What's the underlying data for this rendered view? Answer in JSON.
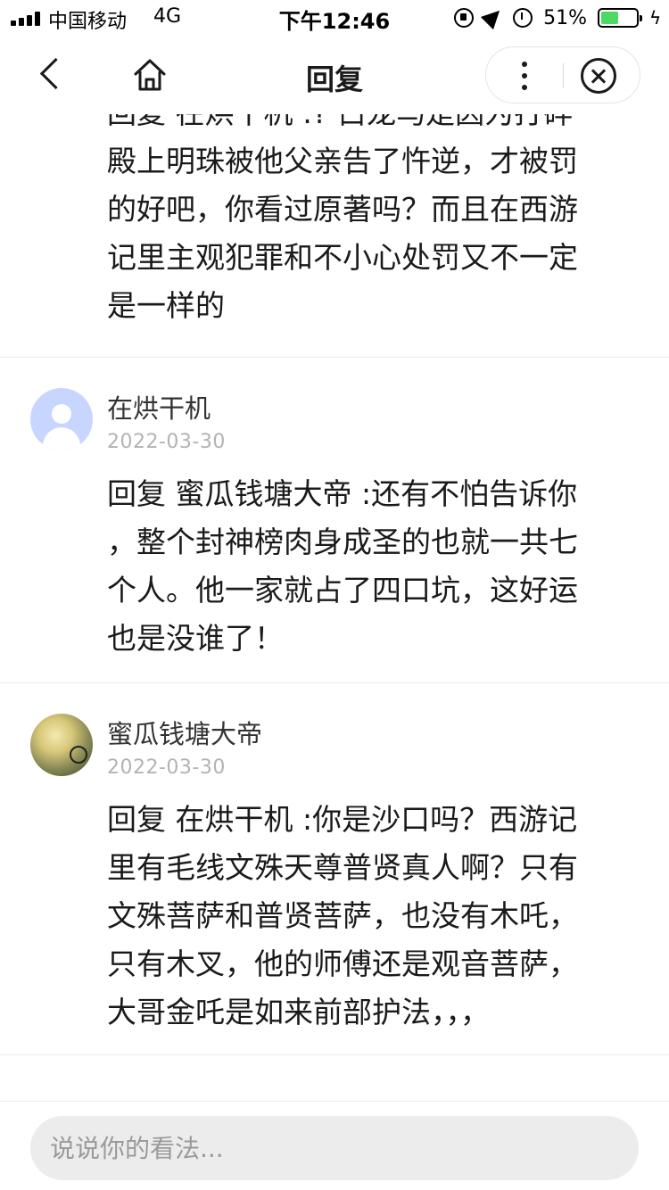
{
  "status_bar": {
    "carrier": "中国移动",
    "network": "4G",
    "time": "下午12:46",
    "battery": "51%",
    "battery_level": 0.51
  },
  "nav": {
    "title": "回复"
  },
  "partial_reply": {
    "lines": [
      "回复 在烘干机 :? 白龙马是因为打碎",
      "殿上明珠被他父亲告了忤逆，才被罚",
      "的好吧，你看过原著吗？而且在西游",
      "记里主观犯罪和不小心处罚又不一定",
      "是一样的"
    ]
  },
  "comments": [
    {
      "avatar": "default-user-icon",
      "name": "在烘干机",
      "date": "2022-03-30",
      "lines": [
        "回复 蜜瓜钱塘大帝 :还有不怕告诉你",
        "，整个封神榜肉身成圣的也就一共七",
        "个人。他一家就占了四口坑，这好运",
        "也是没谁了！"
      ]
    },
    {
      "avatar": "photo",
      "name": "蜜瓜钱塘大帝",
      "date": "2022-03-30",
      "lines": [
        "回复 在烘干机 :你是沙口吗？西游记",
        "里有毛线文殊天尊普贤真人啊？只有",
        "文殊菩萨和普贤菩萨，也没有木吒，",
        "只有木叉，他的师傅还是观音菩萨，",
        "大哥金吒是如来前部护法，，，"
      ]
    }
  ],
  "input": {
    "placeholder": "说说你的看法..."
  }
}
